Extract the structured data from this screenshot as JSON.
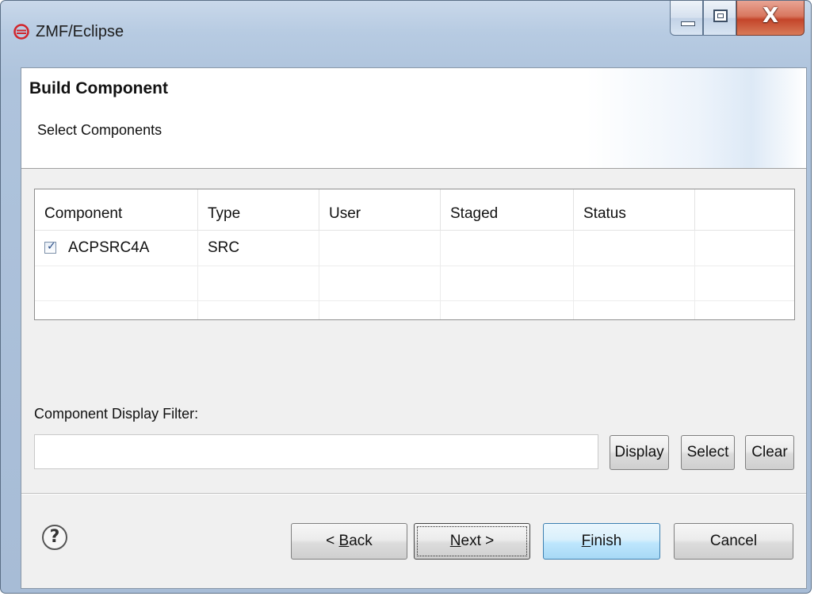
{
  "window": {
    "title": "ZMF/Eclipse",
    "icon": "zmf-logo-icon",
    "controls": {
      "minimize": "minimize-icon",
      "maximize": "maximize-icon",
      "close": "X"
    }
  },
  "header": {
    "title": "Build Component",
    "subtitle": "Select Components"
  },
  "table": {
    "columns": [
      "Component",
      "Type",
      "User",
      "Staged",
      "Status",
      ""
    ],
    "rows": [
      {
        "checked": true,
        "component": "ACPSRC4A",
        "type": "SRC",
        "user": "",
        "staged": "",
        "status": ""
      }
    ]
  },
  "filter": {
    "label": "Component Display Filter:",
    "value": "",
    "placeholder": "",
    "buttons": {
      "display": "Display",
      "select": "Select",
      "clear": "Clear"
    }
  },
  "footer": {
    "help": "?",
    "back": {
      "prefix": "< ",
      "mnemonic": "B",
      "rest": "ack"
    },
    "next": {
      "mnemonic": "N",
      "rest": "ext >"
    },
    "finish": {
      "mnemonic": "F",
      "rest": "inish"
    },
    "cancel": "Cancel"
  },
  "colors": {
    "window_frame": "#aec3dc",
    "close_button": "#c4452a",
    "default_button": "#a7d9f5",
    "dialog_bg": "#f0f0f0"
  }
}
